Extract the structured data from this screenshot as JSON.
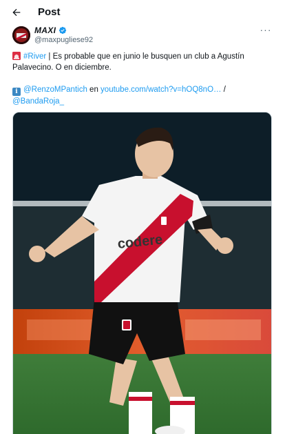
{
  "header": {
    "title": "Post",
    "back_icon": "arrow-left-icon"
  },
  "author": {
    "display_name": "MAXI",
    "handle": "@maxpugliese92",
    "verified": true,
    "verified_color": "#1d9bf0",
    "more_icon": "more-horizontal-icon"
  },
  "tweet": {
    "siren_icon": "rotating-light-icon",
    "hashtag": "#River",
    "text_after_hashtag": " | Es probable que en junio le busquen un club a Agustín Palavecino. O en diciembre.",
    "info_icon": "information-icon",
    "mention_1": "@RenzoMPantich",
    "connector": " en ",
    "link": "youtube.com/watch?v=hOQ8nO…",
    "separator": " / ",
    "mention_2": "@BandaRoja_"
  },
  "media": {
    "kind": "photo",
    "sponsor_text": "codere"
  },
  "colors": {
    "link": "#1d9bf0",
    "text": "#0f1419",
    "secondary": "#536471"
  }
}
